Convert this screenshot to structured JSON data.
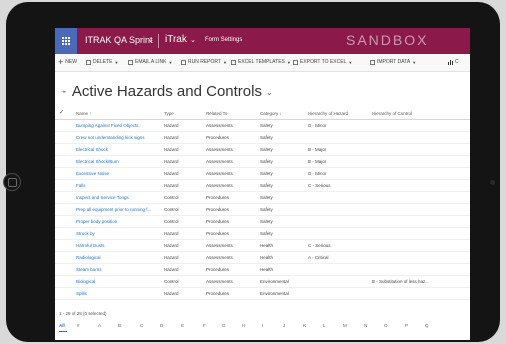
{
  "header": {
    "app_title": "ITRAK QA Sprint",
    "app_name": "iTrak",
    "area": "Form Settings",
    "environment": "SANDBOX"
  },
  "commands": [
    "NEW",
    "DELETE",
    "EMAIL A LINK",
    "RUN REPORT",
    "EXCEL TEMPLATES",
    "EXPORT TO EXCEL",
    "IMPORT DATA",
    "C"
  ],
  "view": {
    "title": "Active Hazards and Controls"
  },
  "grid": {
    "columns": [
      "Name ↑",
      "Type",
      "Related To",
      "Category ↓",
      "Hierarchy of Hazard",
      "Hierarchy of Control"
    ],
    "rows": [
      [
        "Bumping Against Fixed Objects",
        "Hazard",
        "Assessments",
        "Safety",
        "D - Minor",
        ""
      ],
      [
        "Crew not understanding kick signs",
        "Hazard",
        "Procedures",
        "Safety",
        "",
        ""
      ],
      [
        "Electrical Shock",
        "Hazard",
        "Assessments",
        "Safety",
        "B - Major",
        ""
      ],
      [
        "Electrical Shock/Burn",
        "Hazard",
        "Assessments",
        "Safety",
        "B - Major",
        ""
      ],
      [
        "Excessive Noise",
        "Hazard",
        "Assessments",
        "Safety",
        "D - Minor",
        ""
      ],
      [
        "Falls",
        "Hazard",
        "Assessments",
        "Safety",
        "C - Serious",
        ""
      ],
      [
        "Inspect and Service Tongs",
        "Control",
        "Procedures",
        "Safety",
        "",
        ""
      ],
      [
        "Prep all equipment prior to running f...",
        "Control",
        "Procedures",
        "Safety",
        "",
        ""
      ],
      [
        "Proper body position",
        "Control",
        "Procedures",
        "Safety",
        "",
        ""
      ],
      [
        "Struck by",
        "Hazard",
        "Procedures",
        "Safety",
        "",
        ""
      ],
      [
        "Harmful Dusts",
        "Hazard",
        "Assessments",
        "Health",
        "C - Serious",
        ""
      ],
      [
        "Radiological",
        "Hazard",
        "Assessments",
        "Health",
        "A - Critical",
        ""
      ],
      [
        "Steam burns",
        "Hazard",
        "Procedures",
        "Health",
        "",
        ""
      ],
      [
        "Biological",
        "Control",
        "Assessments",
        "Environmental",
        "",
        "B - Substitution of less haz..."
      ],
      [
        "Spills",
        "Hazard",
        "Procedures",
        "Environmental",
        "",
        ""
      ]
    ]
  },
  "footer": {
    "count": "1 - 28 of 28 (0 selected)"
  },
  "alpha": [
    "All",
    "#",
    "A",
    "B",
    "C",
    "D",
    "E",
    "F",
    "G",
    "H",
    "I",
    "J",
    "K",
    "L",
    "M",
    "N",
    "O",
    "P",
    "Q"
  ]
}
